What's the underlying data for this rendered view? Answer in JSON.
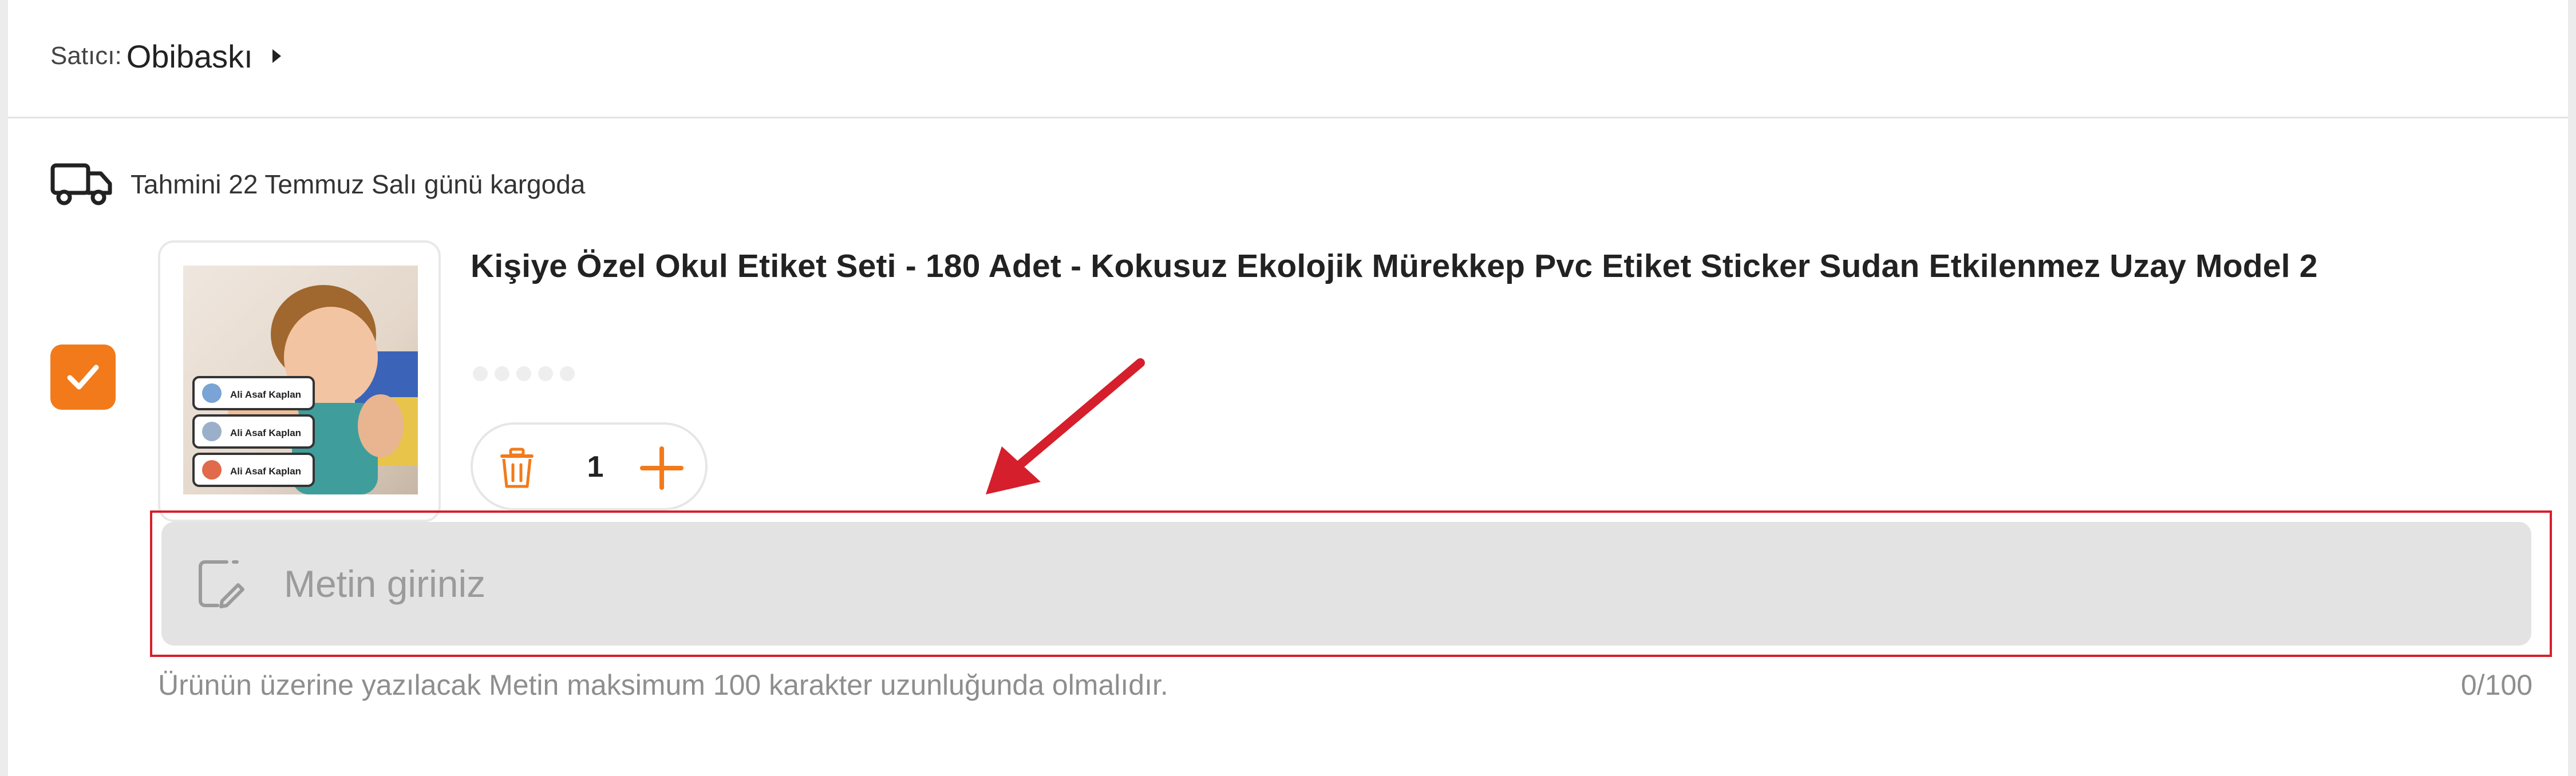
{
  "seller": {
    "label": "Satıcı:",
    "name": "Obibaskı"
  },
  "delivery": {
    "icon": "truck-icon",
    "text": "Tahmini 22 Temmuz Salı günü kargoda"
  },
  "product": {
    "selected": true,
    "title": "Kişiye Özel Okul Etiket Seti - 180 Adet - Kokusuz Ekolojik Mürekkep Pvc Etiket Sticker Sudan Etkilenmez Uzay Model 2",
    "image_labels": [
      "Ali Asaf Kaplan",
      "Ali Asaf Kaplan",
      "Ali Asaf Kaplan"
    ],
    "quantity": "1"
  },
  "custom_text": {
    "placeholder": "Metin giriniz",
    "value": "",
    "hint": "Ürünün üzerine yazılacak Metin maksimum 100 karakter uzunluğunda olmalıdır.",
    "counter": "0/100"
  },
  "colors": {
    "accent": "#f27a1a",
    "highlight": "#d61f2c",
    "field_bg": "#e3e3e3"
  }
}
